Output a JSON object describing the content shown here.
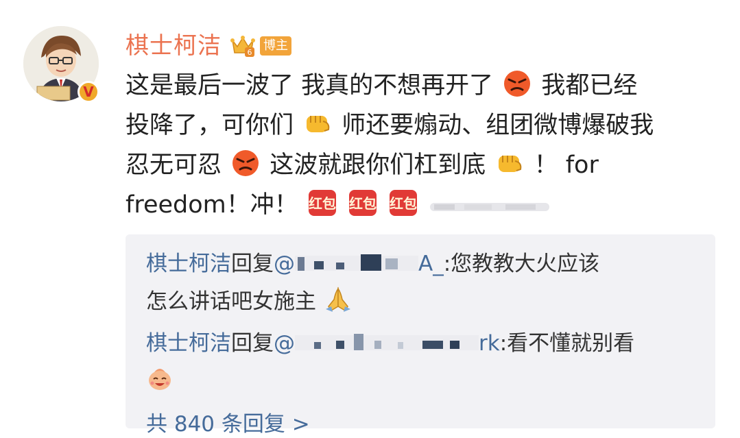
{
  "post": {
    "author": "棋士柯洁",
    "author_tag": "博主",
    "line1_a": "这是最后一波了 我真的不想再开了",
    "line1_b": "我都已经",
    "line2_a": "投降了，可你们",
    "line2_b": "师还要煽动、组团微博爆破我",
    "line3_a": "忍无可忍",
    "line3_b": "这波就跟你们杠到底",
    "line3_c": "！ for",
    "line4_a": "freedom！冲！",
    "emoji_line1": "angry-face",
    "emoji_line2": "fist",
    "emoji_line3a": "angry-face",
    "emoji_line3b": "fist",
    "stickers": [
      "红包",
      "红包",
      "红包"
    ]
  },
  "replies": [
    {
      "author": "棋士柯洁",
      "action": "回复",
      "at": "@",
      "mention_tail": "A_",
      "text_line1": ":您教教大火应该",
      "text_line2": "怎么讲话吧女施主",
      "emoji": "praying-hands"
    },
    {
      "author": "棋士柯洁",
      "action": "回复",
      "at": "@",
      "mention_tail": "rk",
      "text_line1": ":看不懂就别看",
      "emoji": "laughing-doll"
    }
  ],
  "more_replies": "共 840 条回复 >",
  "colors": {
    "username": "#eb7350",
    "link": "#456b9a",
    "reply_bg": "#f2f2f5",
    "tag": "#f2a43a"
  }
}
